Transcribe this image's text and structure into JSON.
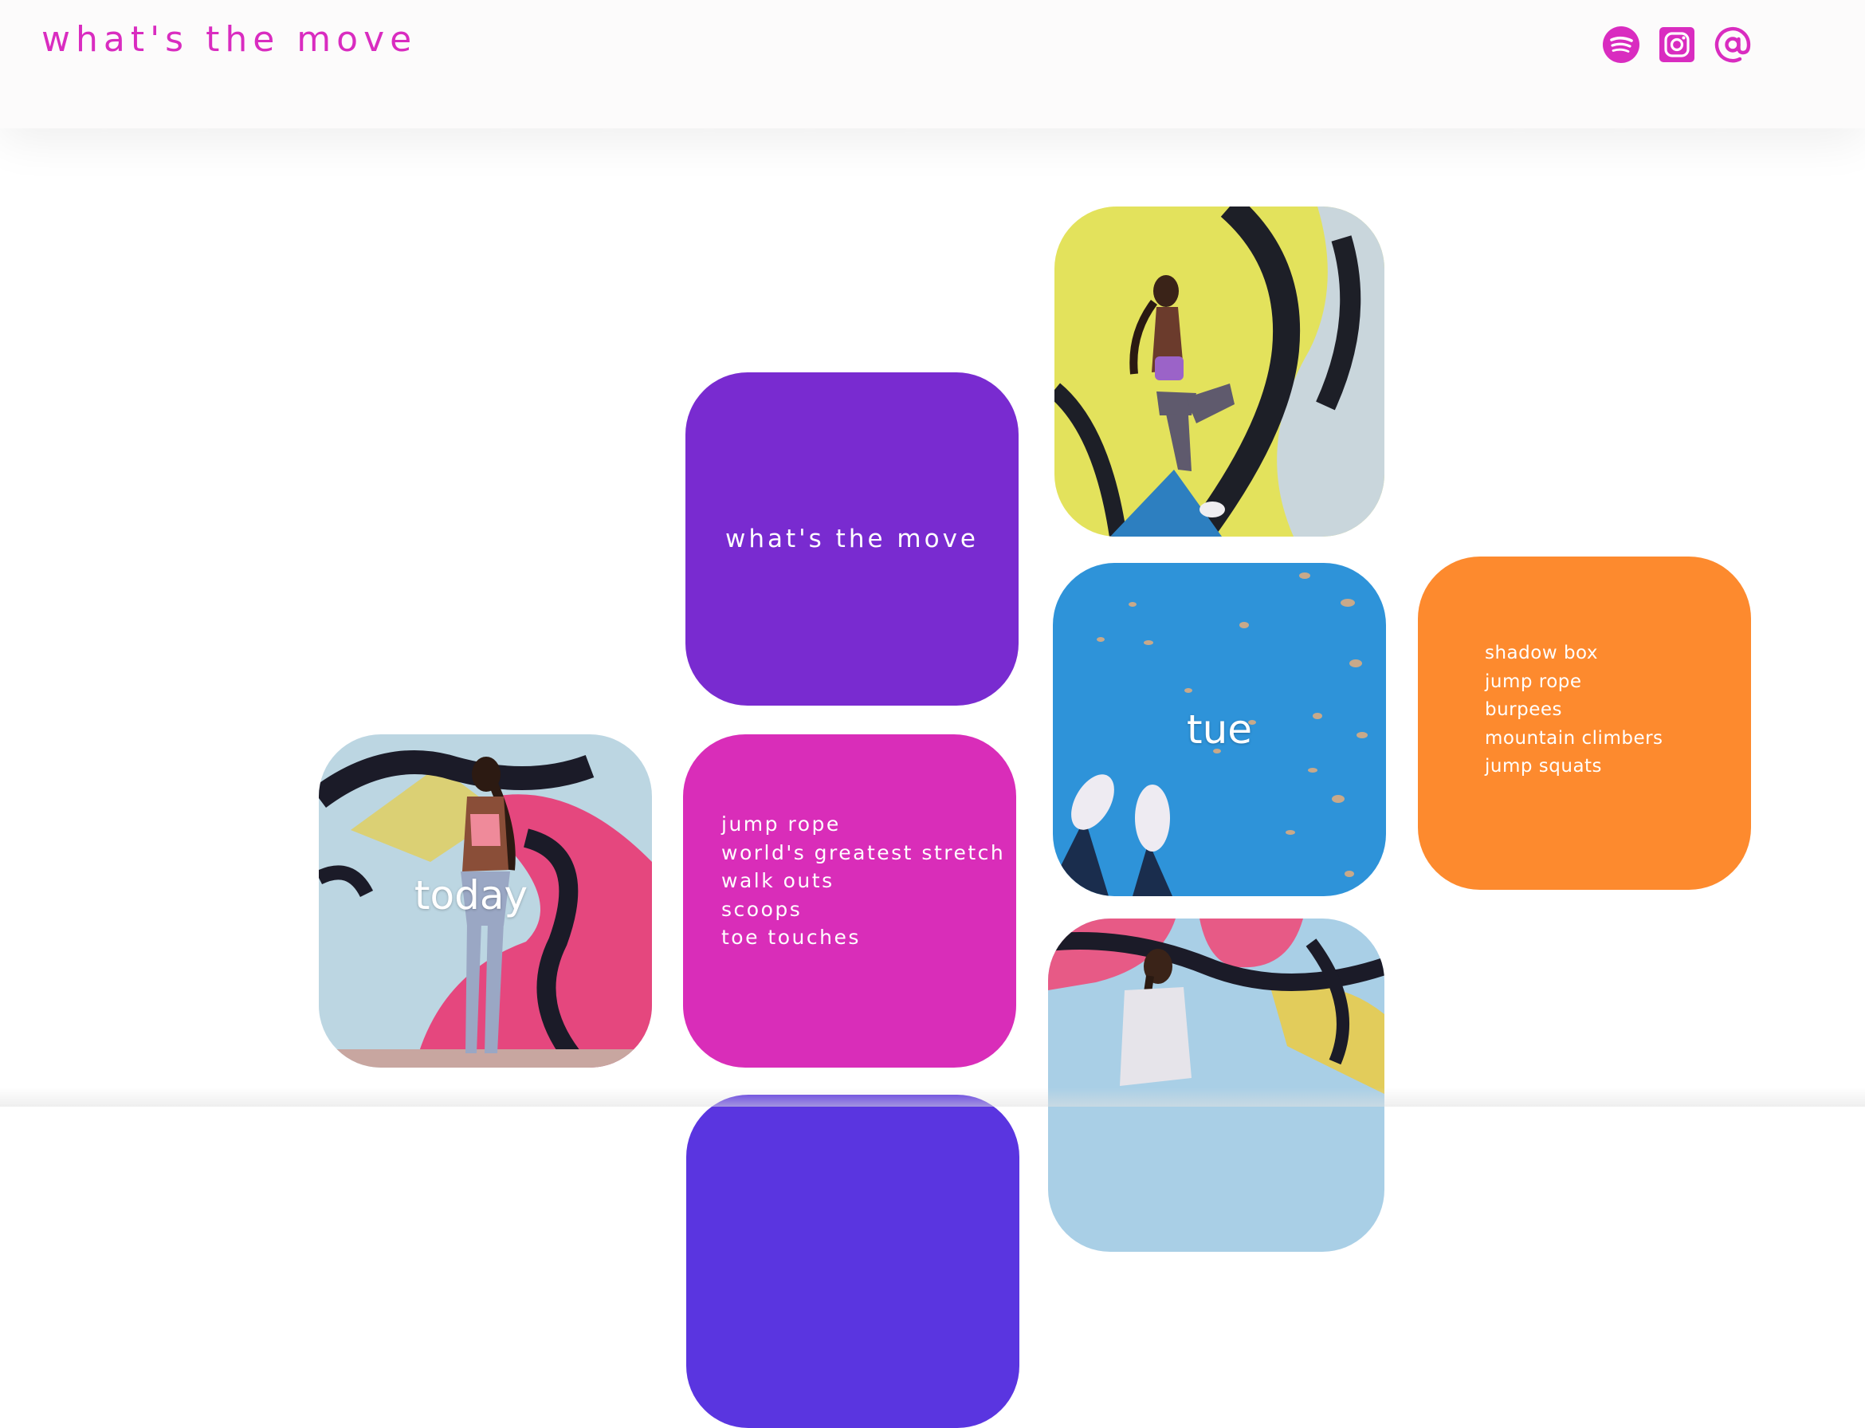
{
  "header": {
    "title": "what's the move",
    "social": [
      {
        "name": "spotify",
        "icon": "spotify-icon"
      },
      {
        "name": "instagram",
        "icon": "instagram-icon"
      },
      {
        "name": "email",
        "icon": "at-sign-icon"
      }
    ]
  },
  "tiles": {
    "title_tile": {
      "label": "what's the move",
      "color": "#792bd0"
    },
    "today": {
      "label": "today"
    },
    "today_list": {
      "color": "#d92db9",
      "items": [
        "jump rope",
        "world's greatest stretch",
        "walk outs",
        "scoops",
        "toe touches"
      ]
    },
    "tue": {
      "label": "tue"
    },
    "tue_list": {
      "color": "#fd8a2e",
      "items": [
        "shadow box",
        "jump rope",
        "burpees",
        "mountain climbers",
        "jump squats"
      ]
    }
  },
  "colors": {
    "accent": "#d92cc0",
    "purple": "#792bd0",
    "pink": "#d92db9",
    "orange": "#fd8a2e",
    "blue": "#2e93d9",
    "indigo": "#5a35e0"
  }
}
